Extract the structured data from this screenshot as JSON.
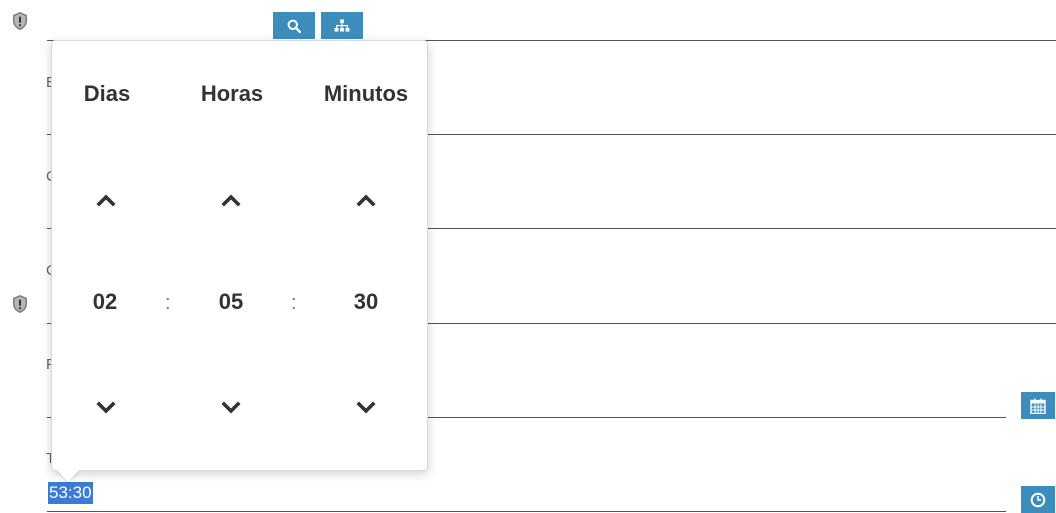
{
  "form": {
    "truncated_labels": [
      "E",
      "C",
      "C",
      "F",
      "T"
    ],
    "time_input_selected_value": "53:30"
  },
  "icons": {
    "shield": "shield-warning-icon",
    "search": "search-icon",
    "hierarchy": "sitemap-icon",
    "calendar": "calendar-icon",
    "clock": "clock-icon"
  },
  "duration_picker": {
    "columns": [
      {
        "label": "Dias",
        "value": "02"
      },
      {
        "label": "Horas",
        "value": "05"
      },
      {
        "label": "Minutos",
        "value": "30"
      }
    ],
    "separator": ":"
  },
  "colors": {
    "accent": "#3c8dbc",
    "selection": "#3a7bd5"
  }
}
